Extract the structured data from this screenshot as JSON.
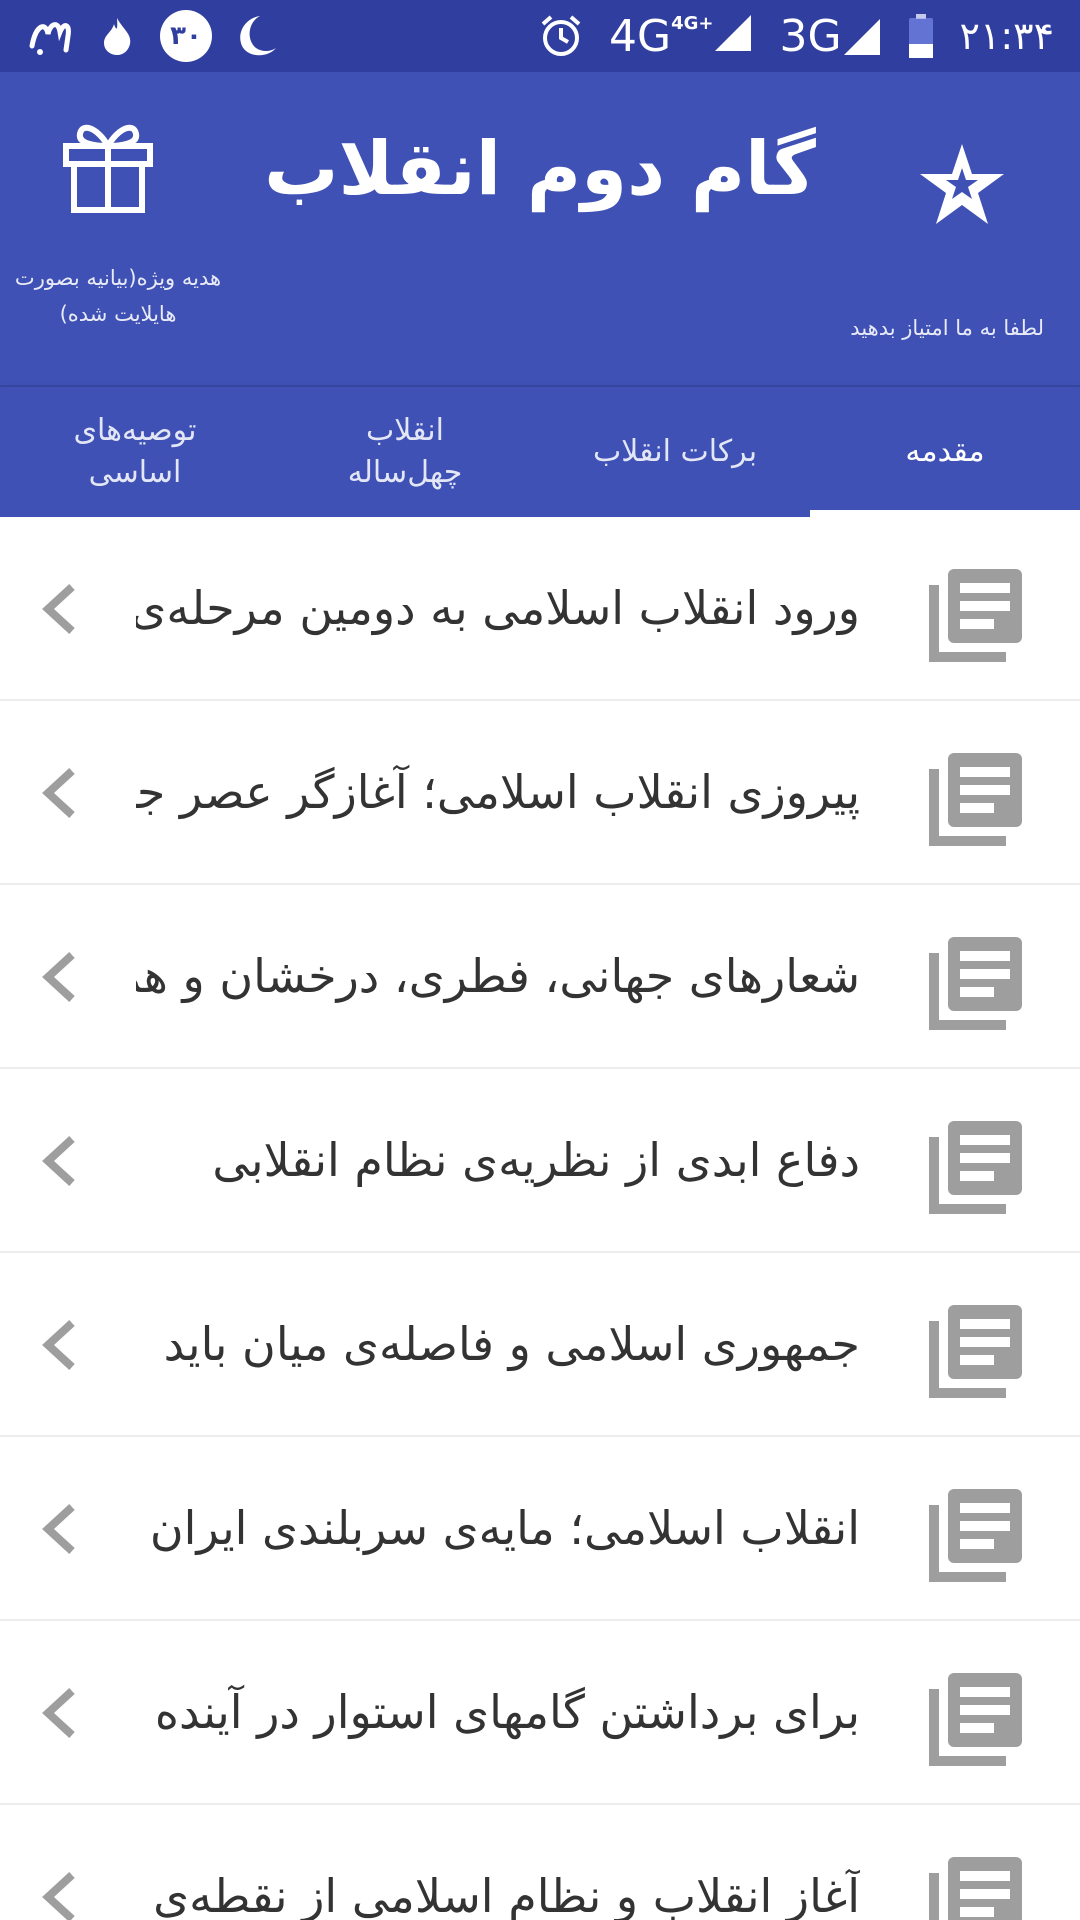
{
  "status_bar": {
    "time": "۲۱:۳۴",
    "net_4g": "4G",
    "net_4g_plus": "4G+",
    "net_3g": "3G",
    "badge_number": "۳۰"
  },
  "header": {
    "title": "گام دوم انقلاب",
    "gift_caption": "هدیه ویژه(بیانیه بصورت هایلایت شده)",
    "rate_caption": "لطفا به ما امتیاز بدهید",
    "background_color": "#3F51B5",
    "status_bar_color": "#303F9F"
  },
  "tabs": [
    {
      "label": "مقدمه",
      "active": true
    },
    {
      "label": "برکات انقلاب",
      "active": false
    },
    {
      "label": "انقلاب چهل‌ساله",
      "active": false
    },
    {
      "label": "توصیه‌های اساسی",
      "active": false
    }
  ],
  "list": {
    "item_icon": "article-icon",
    "chevron_icon": "chevron-left-icon",
    "items": [
      {
        "title": "ورود انقلاب اسلامی به دومین مرحله‌ی"
      },
      {
        "title": "پیروزی انقلاب اسلامی؛ آغازگر عصر جدید"
      },
      {
        "title": "شعارهای جهانی، فطری، درخشان و همیشه زنده"
      },
      {
        "title": "دفاع ابدی از نظریه‌ی نظام انقلابی"
      },
      {
        "title": "جمهوری اسلامی و فاصله‌ی میان باید"
      },
      {
        "title": "انقلاب اسلامی؛ مایه‌ی سربلندی ایران"
      },
      {
        "title": "برای برداشتن گامهای استوار در آینده"
      },
      {
        "title": "آغاز انقلاب و نظام اسلامی از نقطه‌ی"
      }
    ]
  }
}
